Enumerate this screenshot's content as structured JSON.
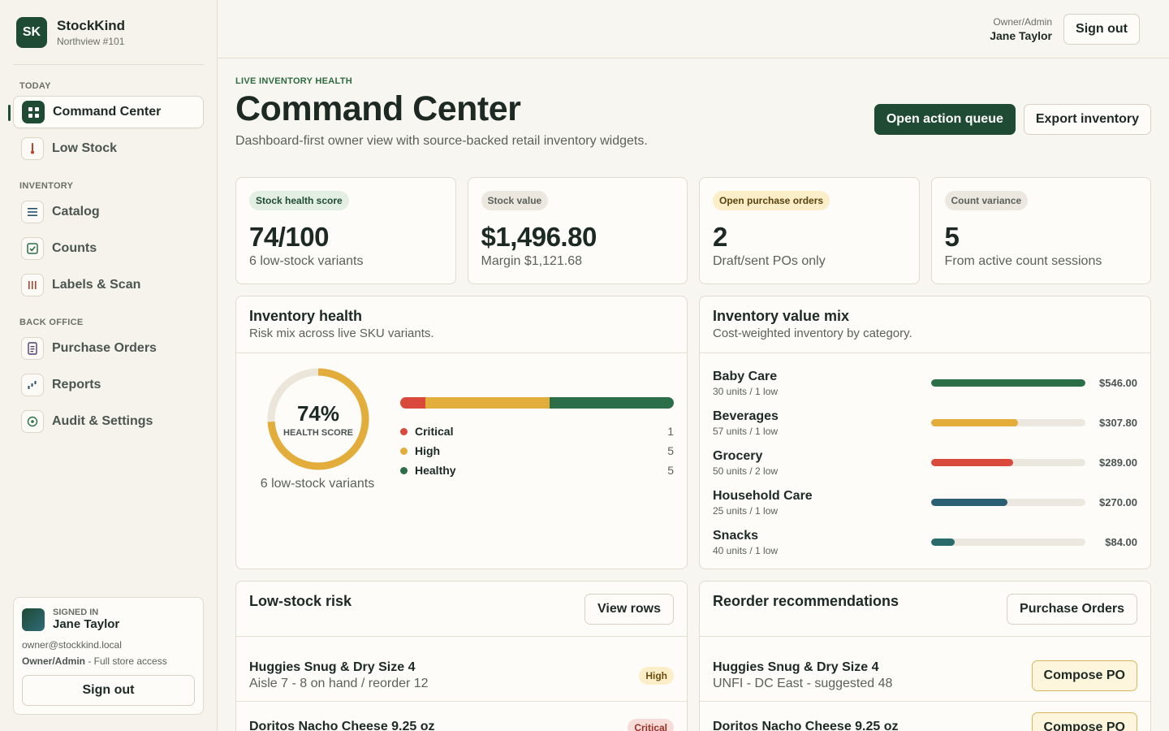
{
  "brand": {
    "logo": "SK",
    "name": "StockKind",
    "store": "Northview #101"
  },
  "sidebar": {
    "sections": [
      {
        "label": "Today"
      },
      {
        "label": "Inventory"
      },
      {
        "label": "Back office"
      }
    ],
    "items": [
      {
        "label": "Command Center",
        "icon": "grid-icon",
        "active": true
      },
      {
        "label": "Low Stock",
        "icon": "thermometer-icon"
      },
      {
        "label": "Catalog",
        "icon": "list-icon"
      },
      {
        "label": "Counts",
        "icon": "checkbox-icon"
      },
      {
        "label": "Labels & Scan",
        "icon": "barcode-icon"
      },
      {
        "label": "Purchase Orders",
        "icon": "document-icon"
      },
      {
        "label": "Reports",
        "icon": "chart-icon"
      },
      {
        "label": "Audit & Settings",
        "icon": "target-icon"
      }
    ],
    "signed_in": {
      "label": "Signed in",
      "name": "Jane Taylor",
      "email": "owner@stockkind.local",
      "role": "Owner/Admin",
      "role_desc": " - Full store access",
      "signout": "Sign out"
    }
  },
  "topbar": {
    "role": "Owner/Admin",
    "name": "Jane Taylor",
    "signout": "Sign out"
  },
  "header": {
    "eyebrow": "Live inventory health",
    "title": "Command Center",
    "subtitle": "Dashboard-first owner view with source-backed retail inventory widgets.",
    "primary_action": "Open action queue",
    "secondary_action": "Export inventory"
  },
  "kpis": [
    {
      "label": "Stock health score",
      "value": "74/100",
      "sub": "6 low-stock variants"
    },
    {
      "label": "Stock value",
      "value": "$1,496.80",
      "sub": "Margin $1,121.68"
    },
    {
      "label": "Open purchase orders",
      "value": "2",
      "sub": "Draft/sent POs only"
    },
    {
      "label": "Count variance",
      "value": "5",
      "sub": "From active count sessions"
    }
  ],
  "health": {
    "title": "Inventory health",
    "subtitle": "Risk mix across live SKU variants.",
    "score_pct": 74,
    "score_text": "74%",
    "score_label": "HEALTH SCORE",
    "caption": "6 low-stock variants",
    "segments": [
      {
        "label": "Critical",
        "count": 1,
        "count_text": "1",
        "color": "#d94a3d"
      },
      {
        "label": "High",
        "count": 5,
        "count_text": "5",
        "color": "#e3ad3c"
      },
      {
        "label": "Healthy",
        "count": 5,
        "count_text": "5",
        "color": "#2c6e47"
      }
    ]
  },
  "value_mix": {
    "title": "Inventory value mix",
    "subtitle": "Cost-weighted inventory by category.",
    "max": 546.0,
    "categories": [
      {
        "name": "Baby Care",
        "meta": "30 units / 1 low",
        "value": 546.0,
        "value_text": "$546.00",
        "color": "#2c6e47"
      },
      {
        "name": "Beverages",
        "meta": "57 units / 1 low",
        "value": 307.8,
        "value_text": "$307.80",
        "color": "#e3ad3c"
      },
      {
        "name": "Grocery",
        "meta": "50 units / 2 low",
        "value": 289.0,
        "value_text": "$289.00",
        "color": "#d94a3d"
      },
      {
        "name": "Household Care",
        "meta": "25 units / 1 low",
        "value": 270.0,
        "value_text": "$270.00",
        "color": "#2a5f74"
      },
      {
        "name": "Snacks",
        "meta": "40 units / 1 low",
        "value": 84.0,
        "value_text": "$84.00",
        "color": "#2a6a6a"
      }
    ]
  },
  "low_stock": {
    "title": "Low-stock risk",
    "action": "View rows",
    "rows": [
      {
        "name": "Huggies Snug & Dry Size 4",
        "meta": "Aisle 7 - 8 on hand / reorder 12",
        "badge": "High"
      },
      {
        "name": "Doritos Nacho Cheese 9.25 oz",
        "meta": "",
        "badge": "Critical"
      }
    ]
  },
  "reorder": {
    "title": "Reorder recommendations",
    "action": "Purchase Orders",
    "rows": [
      {
        "name": "Huggies Snug & Dry Size 4",
        "meta": "UNFI - DC East - suggested 48",
        "action": "Compose PO"
      },
      {
        "name": "Doritos Nacho Cheese 9.25 oz",
        "meta": "",
        "action": "Compose PO"
      }
    ]
  },
  "colors": {
    "brand": "#1f4a34",
    "critical": "#d94a3d",
    "high": "#e3ad3c",
    "healthy": "#2c6e47"
  }
}
